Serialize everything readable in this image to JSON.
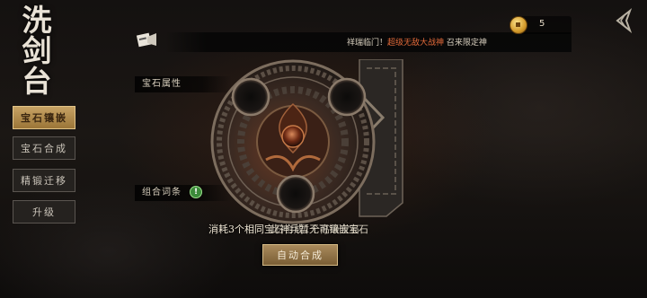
{
  "screen": {
    "title_chars": [
      "洗",
      "剑",
      "台"
    ]
  },
  "sidebar": {
    "items": [
      {
        "label": "宝石镶嵌",
        "active": true
      },
      {
        "label": "宝石合成",
        "active": false
      },
      {
        "label": "精锻迁移",
        "active": false
      },
      {
        "label": "升级",
        "active": false
      }
    ]
  },
  "topbar": {
    "announcement_prefix": "祥瑞临门！",
    "announcement_highlight": "超级无敌大战神",
    "announcement_suffix": "召来限定神"
  },
  "currency": {
    "count": "5",
    "icon": "coin-icon"
  },
  "panel": {
    "gem_attr_label": "宝石属性",
    "combo_label": "组合词条",
    "combo_badge": "!"
  },
  "hint": {
    "text": "消耗3个相同宝石合成1个高级宝石",
    "overlay_text": "此神兵暂无可镶嵌宝石"
  },
  "buttons": {
    "auto_combine": "自动合成"
  },
  "colors": {
    "accent_gold": "#c7a364",
    "highlight_red": "#e36a3a",
    "badge_green": "#3c8a3a"
  }
}
